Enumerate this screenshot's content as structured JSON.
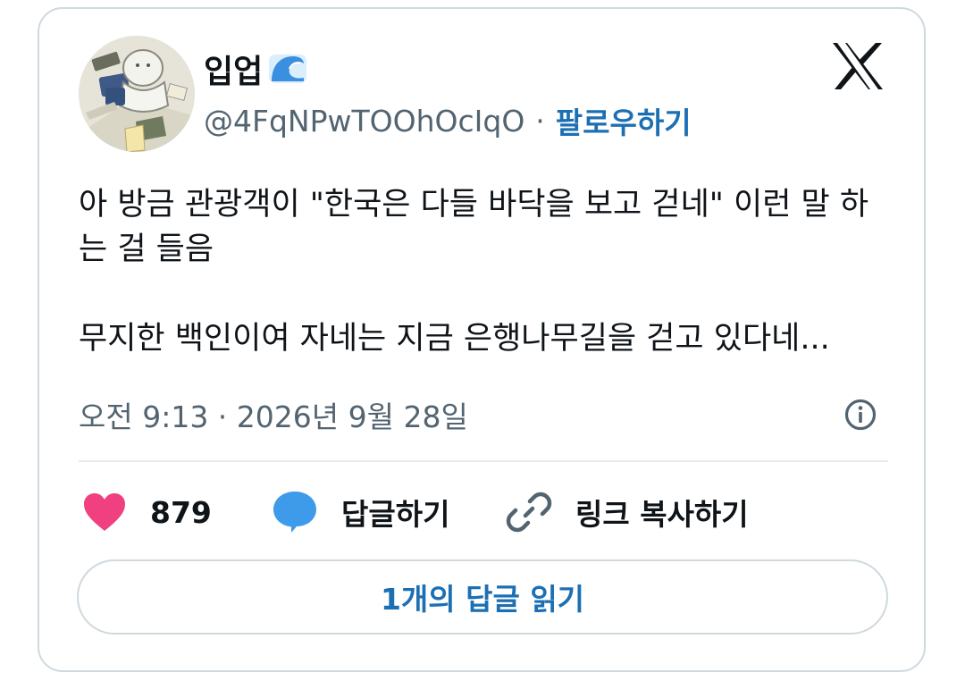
{
  "post": {
    "author": {
      "name": "입업",
      "handle": "@4FqNPwTOOhOcIqO",
      "follow_label": "팔로우하기",
      "separator": "·"
    },
    "text_lines": [
      "아 방금 관광객이 \"한국은 다들 바닥을 보고 걷네\" 이런 말 하",
      "는 걸 들음",
      "무지한 백인이여 자네는 지금 은행나무길을 걷고 있다네..."
    ],
    "timestamp": "오전 9:13 · 2026년 9월 28일"
  },
  "actions": {
    "like_count": "879",
    "reply_label": "답글하기",
    "copy_link_label": "링크 복사하기"
  },
  "read_replies_label": "1개의 답글 읽기",
  "icons": [
    "avatar",
    "wave-icon",
    "x-logo-icon",
    "info-icon",
    "heart-icon",
    "reply-bubble-icon",
    "link-icon"
  ],
  "colors": {
    "text": "#0f1419",
    "secondary_text": "#536471",
    "link_blue": "#1d6fb3",
    "border": "#cfd9de",
    "heart": "#f0407f",
    "bubble": "#3d9be9"
  }
}
